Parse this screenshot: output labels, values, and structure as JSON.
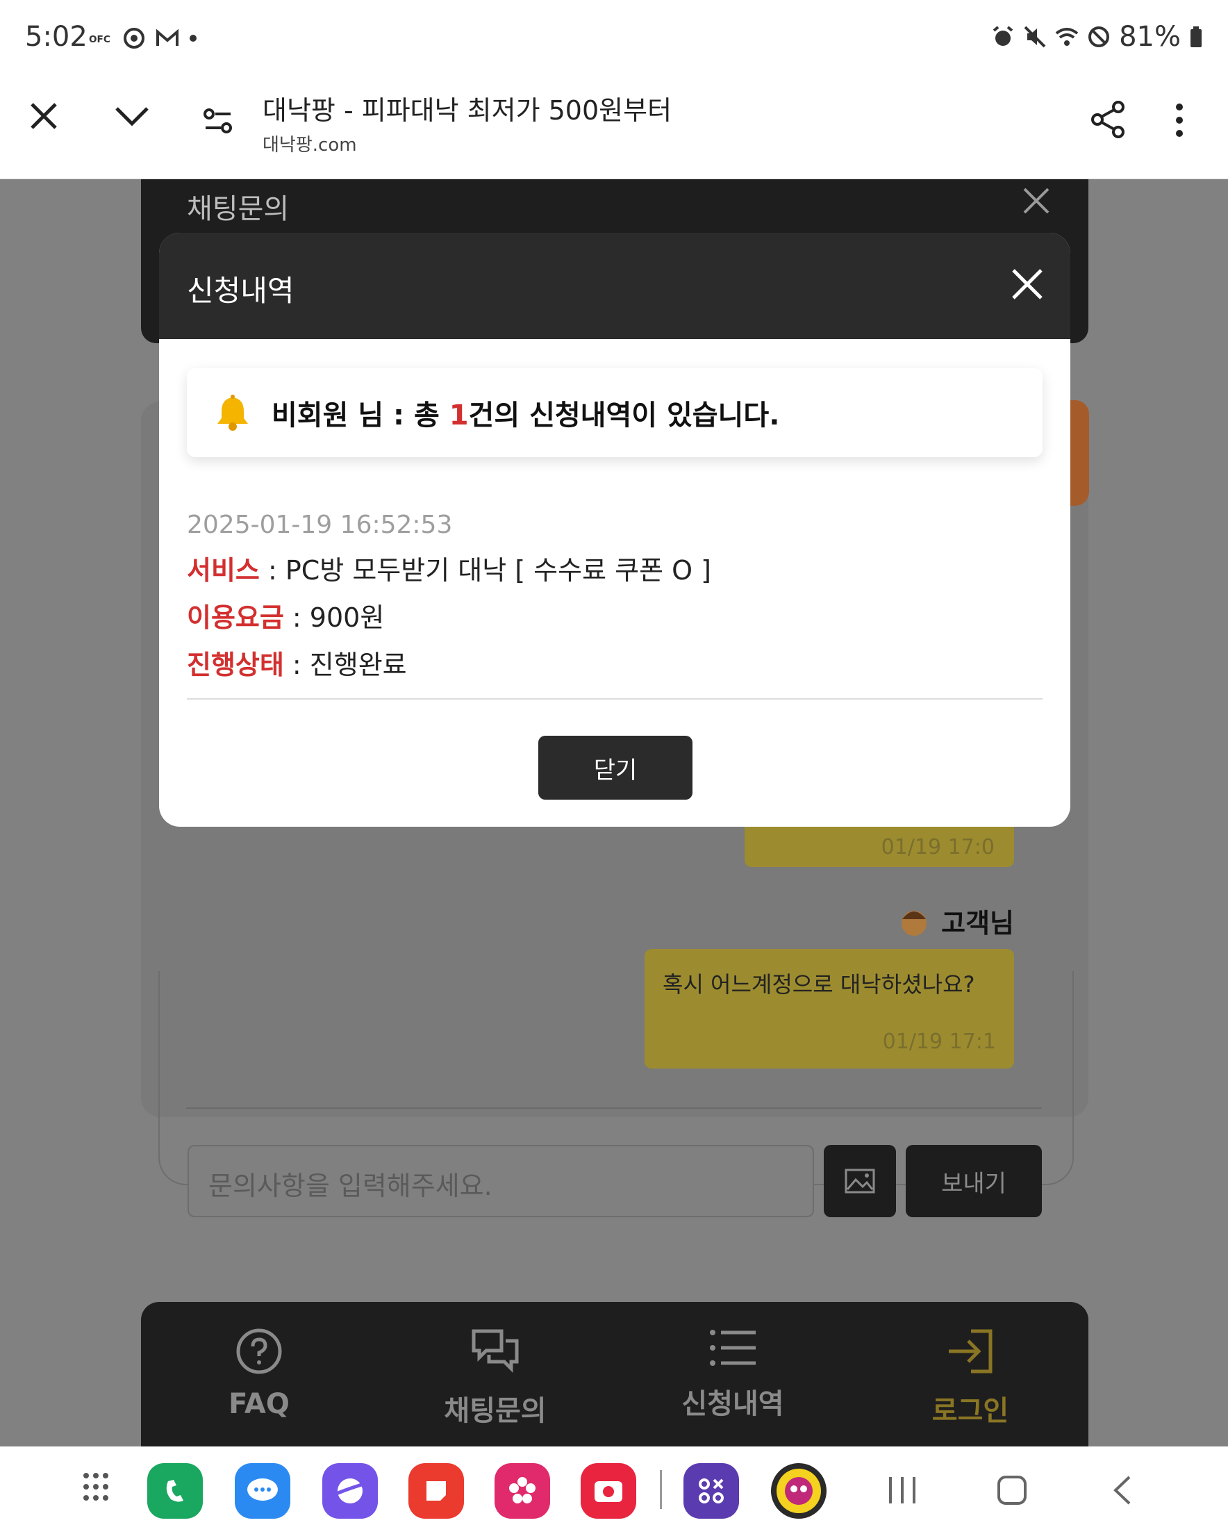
{
  "status_bar": {
    "time": "5:02",
    "battery": "81%"
  },
  "browser": {
    "title": "대낙팡 - 피파대낙 최저가 500원부터",
    "url": "대낙팡.com"
  },
  "chat": {
    "header_title": "채팅문의",
    "prev_bubble_time": "01/19 17:0",
    "customer_name": "고객님",
    "customer_message": "혹시 어느계정으로 대낙하셨나요?",
    "customer_message_time": "01/19 17:1",
    "input_placeholder": "문의사항을 입력해주세요.",
    "send_label": "보내기"
  },
  "bottom_nav": [
    {
      "label": "FAQ",
      "icon": "help-circle-icon"
    },
    {
      "label": "채팅문의",
      "icon": "chat-bubbles-icon"
    },
    {
      "label": "신청내역",
      "icon": "list-icon"
    },
    {
      "label": "로그인",
      "icon": "login-icon"
    }
  ],
  "modal": {
    "title": "신청내역",
    "notice_prefix": "비회원 님 : 총 ",
    "notice_count": "1",
    "notice_suffix": "건의 신청내역이 있습니다.",
    "order": {
      "datetime": "2025-01-19 16:52:53",
      "service_label": "서비스",
      "service_value": " : PC방 모두받기 대낙 [ 수수료 쿠폰 O ]",
      "fee_label": "이용요금",
      "fee_value": " : 900원",
      "status_label": "진행상태",
      "status_value": " : 진행완료"
    },
    "close_button": "닫기"
  },
  "colors": {
    "accent_red": "#d32f2f",
    "dark": "#2b2b2b",
    "bubble_yellow": "#f2d844"
  }
}
